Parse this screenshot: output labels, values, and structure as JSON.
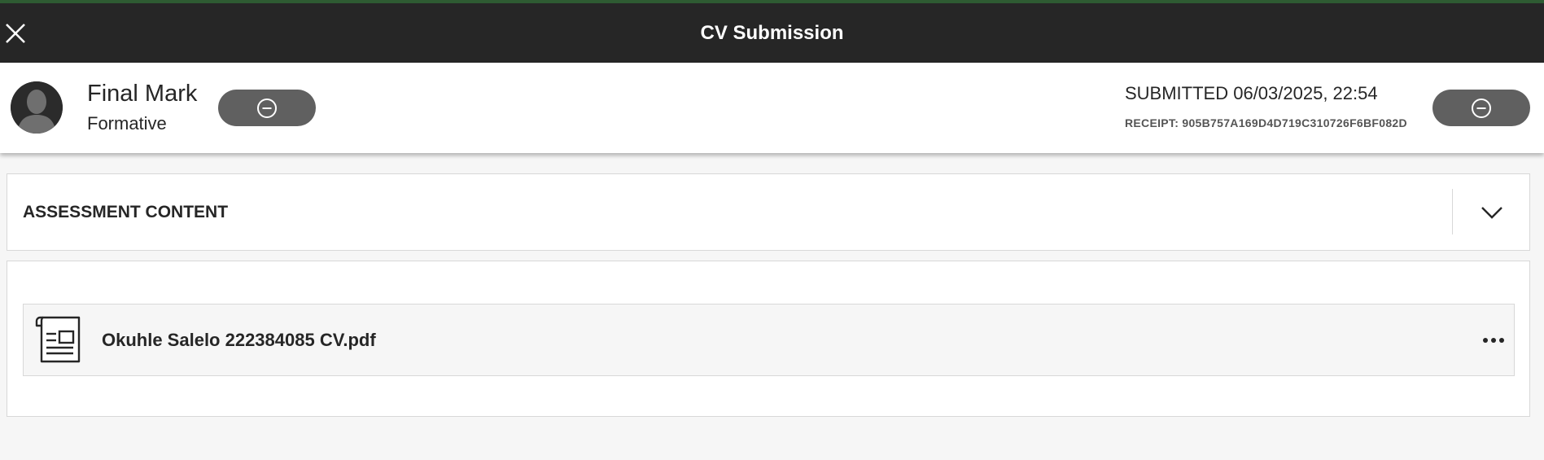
{
  "window": {
    "title": "CV Submission"
  },
  "header": {
    "mark_label": "Final Mark",
    "mark_sub": "Formative",
    "submitted": "SUBMITTED 06/03/2025, 22:54",
    "receipt": "RECEIPT: 905B757A169D4D719C310726F6BF082D"
  },
  "assessment": {
    "title": "ASSESSMENT CONTENT"
  },
  "file": {
    "name": "Okuhle Salelo 222384085 CV.pdf"
  },
  "icons": {
    "close": "close-icon",
    "avatar": "user-avatar-icon",
    "minus": "minus-circle-icon",
    "chevron": "chevron-down-icon",
    "document": "document-icon",
    "more": "more-options-icon"
  },
  "colors": {
    "titlebar": "#262626",
    "accent_line": "#2e5b32",
    "pill": "#606060",
    "background": "#f6f6f6"
  }
}
